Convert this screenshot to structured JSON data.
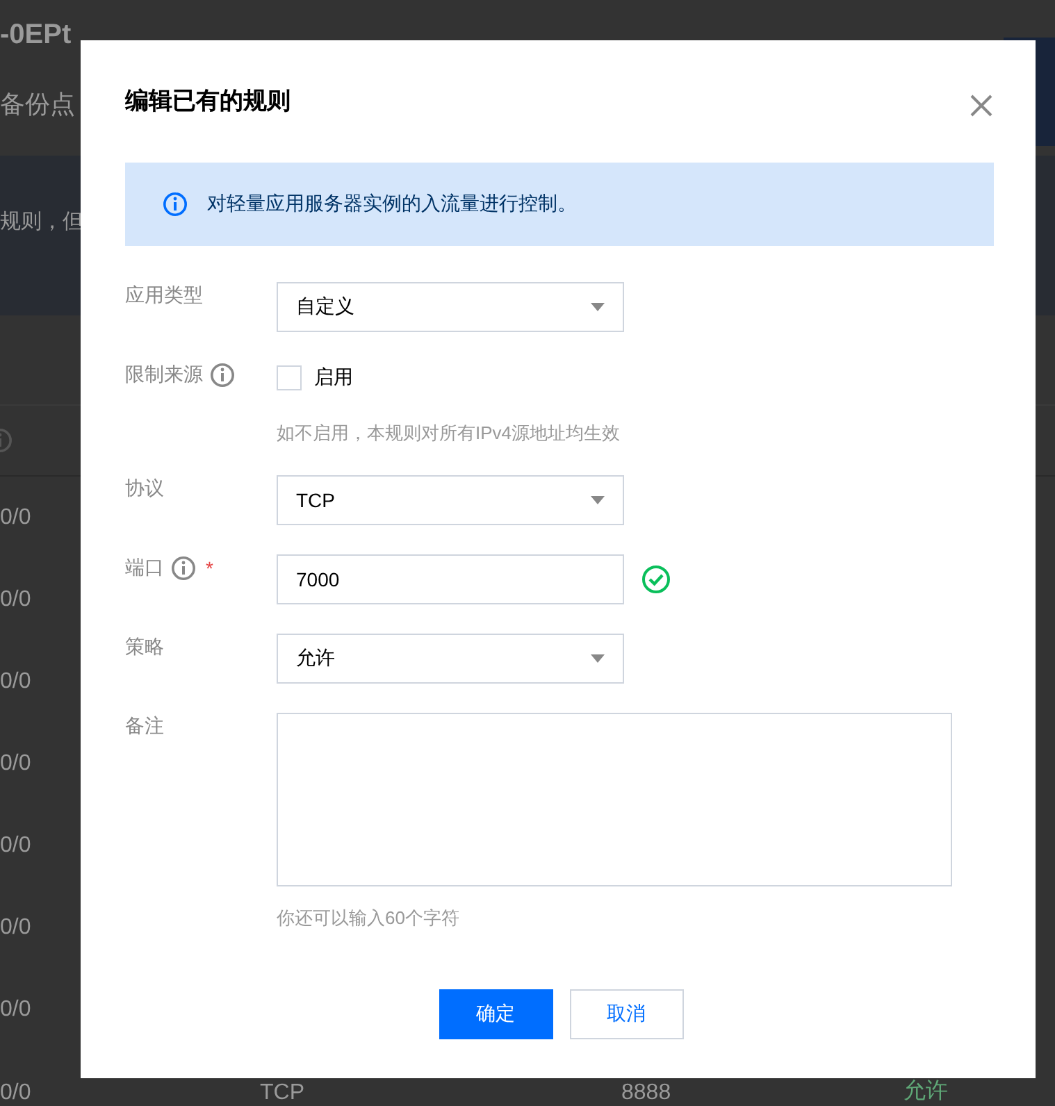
{
  "background": {
    "title": "-0EPt",
    "subtitle": "备份点",
    "notice": "规则，但",
    "rows": [
      {
        "column_1": "0/0"
      },
      {
        "column_1": "0/0"
      },
      {
        "column_1": "0/0"
      },
      {
        "column_1": "0/0"
      },
      {
        "column_1": "0/0"
      },
      {
        "column_1": "0/0"
      },
      {
        "column_1": "0/0"
      },
      {
        "column_1": "0/0",
        "column_2": "TCP",
        "column_3": "8888",
        "column_4": "允许"
      }
    ]
  },
  "dialog": {
    "title": "编辑已有的规则",
    "info": "对轻量应用服务器实例的入流量进行控制。",
    "fields": [
      {
        "kind": "select",
        "label": "应用类型",
        "info": false,
        "value": "自定义"
      },
      {
        "kind": "checkbox",
        "label": "限制来源",
        "info": true,
        "checkbox_label": "启用",
        "checked": false,
        "hint": "如不启用，本规则对所有IPv4源地址均生效"
      },
      {
        "kind": "select",
        "label": "协议",
        "info": false,
        "value": "TCP"
      },
      {
        "kind": "input",
        "label": "端口",
        "info": true,
        "required_mark": "*",
        "value": "7000",
        "valid": true
      },
      {
        "kind": "select",
        "label": "策略",
        "info": false,
        "value": "允许"
      },
      {
        "kind": "textarea",
        "label": "备注",
        "info": false,
        "hint": "你还可以输入60个字符"
      }
    ],
    "buttons": [
      {
        "label": "确定",
        "primary": true
      },
      {
        "label": "取消",
        "primary": false
      }
    ]
  }
}
